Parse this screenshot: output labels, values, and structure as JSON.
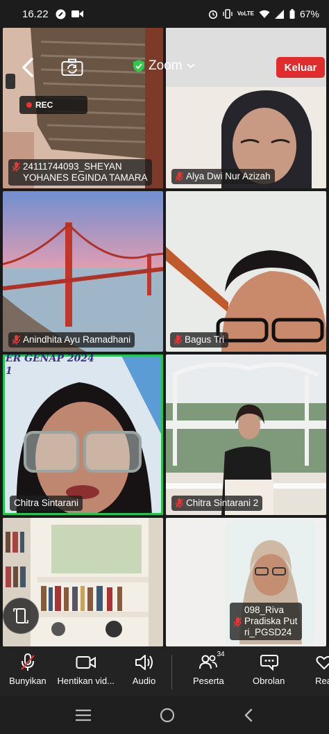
{
  "status_bar": {
    "time": "16.22",
    "battery": "67%",
    "network": "VoLTE"
  },
  "header": {
    "title": "Zoom",
    "leave_label": "Keluar",
    "rec_label": "REC"
  },
  "participants": [
    {
      "name_line1": "24111744093_SHEYAN",
      "name_line2": "YOHANES EGINDA TAMARA",
      "muted": true
    },
    {
      "name_line1": "Alya Dwi Nur Azizah",
      "muted": true
    },
    {
      "name_line1": "Anindhita Ayu Ramadhani",
      "muted": true
    },
    {
      "name_line1": "Bagus Tri",
      "muted": true
    },
    {
      "name_line1": "Chitra Sintarani",
      "muted": false,
      "active": true,
      "banner_text": "ER GENAP 2024",
      "banner_sub": "1"
    },
    {
      "name_line1": "Chitra Sintarani 2",
      "muted": true
    },
    {
      "name_line1": "",
      "muted": false
    },
    {
      "name_line1": "098_Riva",
      "name_line2": "Pradiska Put",
      "name_line3": "ri_PGSD24",
      "muted": true
    }
  ],
  "toolbar": {
    "items": [
      {
        "label": "Bunyikan",
        "icon": "mic-muted-icon"
      },
      {
        "label": "Hentikan vid...",
        "icon": "video-camera-icon"
      },
      {
        "label": "Audio",
        "icon": "speaker-icon"
      },
      {
        "label": "Peserta",
        "icon": "participants-icon",
        "count": "34"
      },
      {
        "label": "Obrolan",
        "icon": "chat-icon"
      },
      {
        "label": "Rea",
        "icon": "heart-icon"
      }
    ]
  },
  "colors": {
    "leave": "#e02c2c",
    "active_speaker": "#23c552",
    "muted_mic": "#e53935",
    "shield": "#2ec84b"
  }
}
